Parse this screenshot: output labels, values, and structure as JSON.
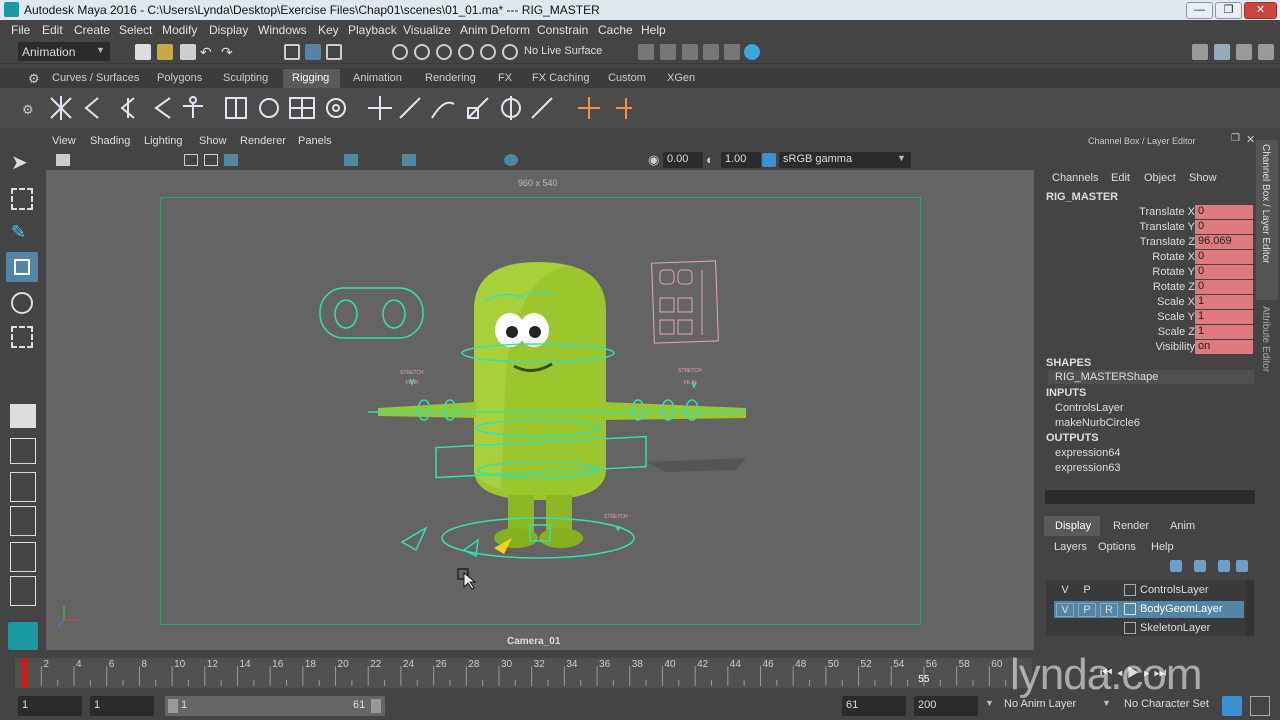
{
  "window": {
    "title": "Autodesk Maya 2016 - C:\\Users\\Lynda\\Desktop\\Exercise Files\\Chap01\\scenes\\01_01.ma*   ---   RIG_MASTER",
    "minimize": "—",
    "restore": "❐",
    "close": "✕"
  },
  "menus": [
    "File",
    "Edit",
    "Create",
    "Select",
    "Modify",
    "Display",
    "Windows",
    "Key",
    "Playback",
    "Visualize",
    "Anim Deform",
    "Constrain",
    "Cache",
    "Help"
  ],
  "status": {
    "mode": "Animation",
    "live_surface": "No Live Surface"
  },
  "shelf_tabs": [
    "Curves / Surfaces",
    "Polygons",
    "Sculpting",
    "Rigging",
    "Animation",
    "Rendering",
    "FX",
    "FX Caching",
    "Custom",
    "XGen"
  ],
  "active_shelf": "Rigging",
  "viewport": {
    "menus": [
      "View",
      "Shading",
      "Lighting",
      "Show",
      "Renderer",
      "Panels"
    ],
    "resolution_gate": "960 x 540",
    "camera": "Camera_01",
    "near_value": "0.00",
    "exposure": "1.00",
    "color_space": "sRGB gamma",
    "ctrl_label_1": "STRETCH",
    "ctrl_label_1b": "FK IK",
    "ctrl_label_2": "STRETCH",
    "ctrl_label_2b": "FK IK",
    "ctrl_label_3": "STRETCH"
  },
  "channel_box": {
    "header": "Channel Box / Layer Editor",
    "menus": [
      "Channels",
      "Edit",
      "Object",
      "Show"
    ],
    "object": "RIG_MASTER",
    "channels": [
      {
        "name": "Translate X",
        "value": "0"
      },
      {
        "name": "Translate Y",
        "value": "0"
      },
      {
        "name": "Translate Z",
        "value": "96.069"
      },
      {
        "name": "Rotate X",
        "value": "0"
      },
      {
        "name": "Rotate Y",
        "value": "0"
      },
      {
        "name": "Rotate Z",
        "value": "0"
      },
      {
        "name": "Scale X",
        "value": "1"
      },
      {
        "name": "Scale Y",
        "value": "1"
      },
      {
        "name": "Scale Z",
        "value": "1"
      },
      {
        "name": "Visibility",
        "value": "on"
      }
    ],
    "shapes_header": "SHAPES",
    "shapes": [
      "RIG_MASTERShape"
    ],
    "inputs_header": "INPUTS",
    "inputs": [
      "ControlsLayer",
      "makeNurbCircle6"
    ],
    "outputs_header": "OUTPUTS",
    "outputs": [
      "expression64",
      "expression63"
    ],
    "side_tab_1": "Channel Box / Layer Editor",
    "side_tab_2": "Attribute Editor"
  },
  "layer_editor": {
    "tabs": [
      "Display",
      "Render",
      "Anim"
    ],
    "menus": [
      "Layers",
      "Options",
      "Help"
    ],
    "layers": [
      {
        "v": "V",
        "p": "P",
        "r": "",
        "name": "ControlsLayer",
        "selected": false
      },
      {
        "v": "V",
        "p": "P",
        "r": "R",
        "name": "BodyGeomLayer",
        "selected": true
      },
      {
        "v": "",
        "p": "",
        "r": "",
        "name": "SkeletonLayer",
        "selected": false
      }
    ]
  },
  "timeline": {
    "ticks": [
      "2",
      "4",
      "6",
      "8",
      "10",
      "12",
      "14",
      "16",
      "18",
      "20",
      "22",
      "24",
      "26",
      "28",
      "30",
      "32",
      "34",
      "36",
      "38",
      "40",
      "42",
      "44",
      "46",
      "48",
      "50",
      "52",
      "54",
      "56",
      "58",
      "60"
    ],
    "current_frame": "55",
    "current_frame_ratio": 0.896,
    "playhead_ratio": 0.0
  },
  "range": {
    "start": "1",
    "anim_start": "1",
    "slider_start": "1",
    "slider_end": "61",
    "end": "61",
    "anim_end": "200",
    "anim_layer": "No Anim Layer",
    "char_set": "No Character Set"
  },
  "watermark": "lynda.com",
  "colors": {
    "selection_blue": "#5285a6",
    "channel_red": "#de7a7f",
    "rig_cyan": "#35e0b0",
    "character_green": "#9bc62d",
    "viewport_bg": "#646464"
  }
}
